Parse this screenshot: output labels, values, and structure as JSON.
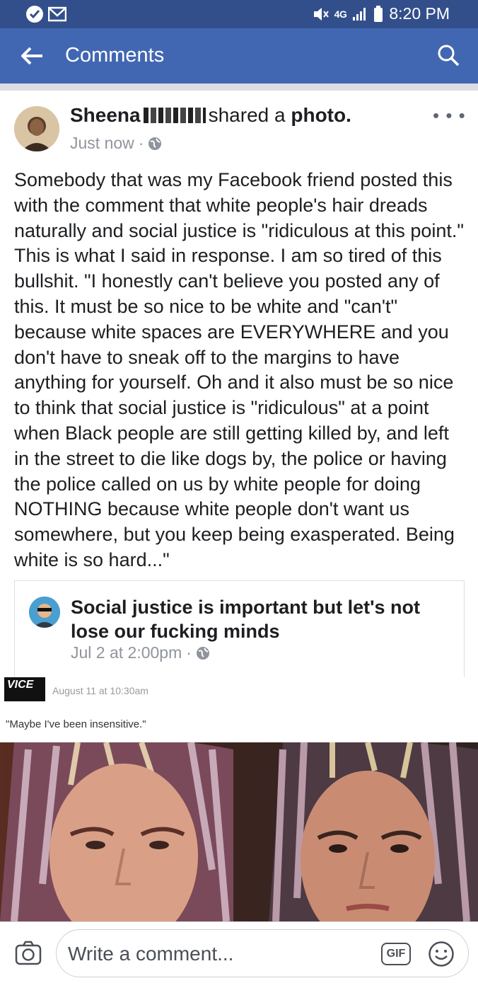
{
  "status_bar": {
    "time": "8:20 PM",
    "network": "4G",
    "icons": [
      "check-circle-icon",
      "mail-icon",
      "mute-icon",
      "signal-icon",
      "battery-icon"
    ]
  },
  "header": {
    "title": "Comments",
    "icons": [
      "back-arrow-icon",
      "search-icon"
    ]
  },
  "post": {
    "author": "Sheena",
    "action_prefix": "shared a",
    "action_object": "photo.",
    "timestamp": "Just now",
    "text": "Somebody that was my Facebook friend posted this with the comment that white people's hair dreads naturally and social justice is \"ridiculous at this point.\" This is what I said in response. I am so tired of this bullshit. \"I honestly can't believe you posted any of this. It must be so nice to be white and \"can't\" because white spaces are EVERYWHERE and you don't have to sneak off to the margins to have anything for yourself. Oh and it also must be so nice to think that social justice is \"ridiculous\" at a point when Black people are still getting killed by, and left in the street to die like dogs by, the police or having the police called on us by white people for doing NOTHING because white people don't want us somewhere, but you keep being exasperated. Being white is so hard...\""
  },
  "shared_post": {
    "title": "Social justice is important but let's not lose our fucking minds",
    "timestamp": "Jul 2 at 2:00pm"
  },
  "embedded_image": {
    "logo": "VICE",
    "date": "August 11 at 10:30am",
    "caption": "\"Maybe I've been insensitive.\""
  },
  "comment_bar": {
    "placeholder": "Write a comment...",
    "gif_label": "GIF"
  },
  "colors": {
    "status_bar": "#334f8b",
    "header": "#4267b2",
    "meta_text": "#90949c"
  }
}
